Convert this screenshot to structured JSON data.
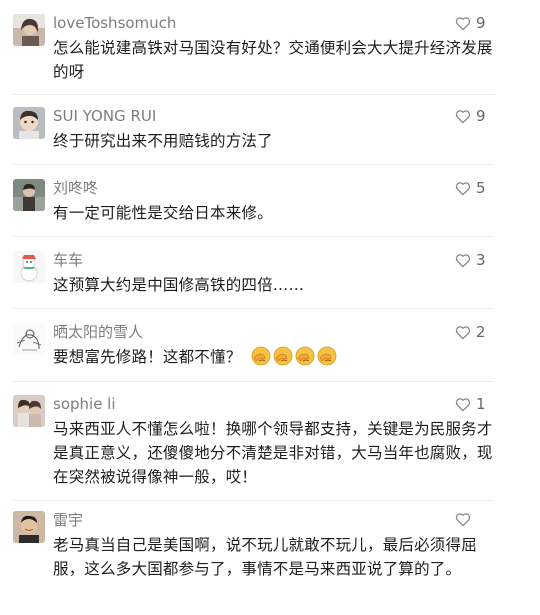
{
  "comments": [
    {
      "username": "loveToshsomuch",
      "text": "怎么能说建高铁对马国没有好处？交通便利会大大提升经济发展的呀",
      "likes": "9",
      "avatar": "photo-avatar-woman"
    },
    {
      "username": "SUI YONG RUI",
      "text": "终于研究出来不用赔钱的方法了",
      "likes": "9",
      "avatar": "photo-avatar-child"
    },
    {
      "username": "刘咚咚",
      "text": "有一定可能性是交给日本来修。",
      "likes": "5",
      "avatar": "photo-avatar-person"
    },
    {
      "username": "车车",
      "text": "这预算大约是中国修高铁的四倍……",
      "likes": "3",
      "avatar": "cartoon-avatar-snowman"
    },
    {
      "username": "晒太阳的雪人",
      "text": "要想富先修路！这都不懂？",
      "likes": "2",
      "avatar": "sketch-avatar",
      "emojis": [
        "facepalm-emoji",
        "facepalm-emoji",
        "facepalm-emoji",
        "facepalm-emoji"
      ]
    },
    {
      "username": "sophie li",
      "text": "马来西亚人不懂怎么啦！换哪个领导都支持，关键是为民服务才是真正意义，还傻傻地分不清楚是非对错，大马当年也腐败，现在突然被说得像神一般，哎！",
      "likes": "1",
      "avatar": "photo-avatar-women"
    },
    {
      "username": "雷宇",
      "text": "老马真当自己是美国啊，说不玩儿就敢不玩儿，最后必须得屈服，这么多大国都参与了，事情不是马来西亚说了算的了。",
      "likes": "",
      "avatar": "photo-avatar-man"
    }
  ],
  "icons": {
    "like": "heart-outline-icon"
  },
  "colors": {
    "username": "#7d7d7d",
    "text": "#1d1d1d",
    "heart": "#8a8a8a",
    "divider": "#ececec"
  }
}
